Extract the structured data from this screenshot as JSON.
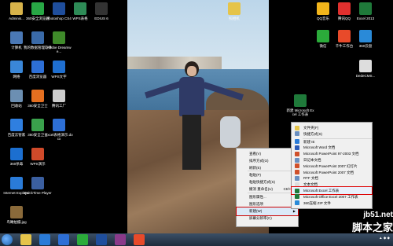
{
  "desktop_icons_left": [
    {
      "label": "Adminis...",
      "color": "#d8b34a"
    },
    {
      "label": "360安全浏览器",
      "color": "#28a745"
    },
    {
      "label": "Photoshop CS4",
      "color": "#1f4e9c"
    },
    {
      "label": "WPS表格",
      "color": "#2e8b57"
    },
    {
      "label": "EDIUS 6",
      "color": "#333333"
    },
    {
      "label": "计算机",
      "color": "#4a78b5"
    },
    {
      "label": "我的数据管理软件",
      "color": "#3a6aa8"
    },
    {
      "label": "Adobe Dreamwe...",
      "color": "#3f8a2a"
    },
    {
      "label": "网络",
      "color": "#3a87d8"
    },
    {
      "label": "百度浏览器",
      "color": "#2d6fd6"
    },
    {
      "label": "WPS文字",
      "color": "#1f6fd0"
    },
    {
      "label": "回收站",
      "color": "#6c8fb2"
    },
    {
      "label": "360安全卫士",
      "color": "#e46f20"
    },
    {
      "label": "腾讯工厂",
      "color": "#cccccc"
    },
    {
      "label": "百度云管家",
      "color": "#2f7fe0"
    },
    {
      "label": "360安全卫士",
      "color": "#3aa14c"
    },
    {
      "label": "Excel表格演示.docx",
      "color": "#2d6fd6"
    },
    {
      "label": "360杀毒",
      "color": "#1c6fd0"
    },
    {
      "label": "WPS演示",
      "color": "#d04a2a"
    },
    {
      "label": "Internet Explorer",
      "color": "#2a7bd8"
    },
    {
      "label": "QuickTime Player",
      "color": "#3b5fa0"
    },
    {
      "label": "鸟瞰拍摄.jpg",
      "color": "#8a6a3a"
    }
  ],
  "desktop_icons_right": [
    {
      "label": "QQ音乐",
      "color": "#f2b51b"
    },
    {
      "label": "腾讯QQ",
      "color": "#e0302e"
    },
    {
      "label": "Excel 2013",
      "color": "#1f7a3a"
    },
    {
      "label": "微信",
      "color": "#2bab3a"
    },
    {
      "label": "千牛工作台",
      "color": "#e84a2a"
    },
    {
      "label": "360云盘",
      "color": "#2a8ad8"
    },
    {
      "label": "DedeCMS...",
      "color": "#dddddd"
    },
    {
      "label": "新建 Microsoft Excel 工作表",
      "color": "#1f7a3a"
    }
  ],
  "wallpaper_folder": {
    "label": "照相机",
    "color": "#e5c44a"
  },
  "context_menu": {
    "items": [
      {
        "label": "查看(V)",
        "arrow": "▶"
      },
      {
        "label": "排序方式(O)",
        "arrow": "▶"
      },
      {
        "label": "刷新(E)",
        "arrow": ""
      },
      {
        "label": "粘贴(P)",
        "arrow": ""
      },
      {
        "label": "粘贴快捷方式(S)",
        "arrow": ""
      },
      {
        "label": "撤消 重命名(U)",
        "shortcut": "Ctrl+Z"
      },
      {
        "label": "图形属性...",
        "arrow": ""
      },
      {
        "label": "图形选项",
        "arrow": "▶"
      },
      {
        "label": "新建(W)",
        "arrow": "▶"
      },
      {
        "label": "屏幕分辨率(C)",
        "arrow": ""
      },
      {
        "label": "小工具(G)",
        "arrow": ""
      },
      {
        "label": "个性化(R)",
        "arrow": ""
      }
    ]
  },
  "new_submenu": {
    "items": [
      {
        "label": "文件夹(F)",
        "color": "#e5c44a"
      },
      {
        "label": "快捷方式(S)",
        "color": "#6a8fc0"
      },
      {
        "label": "新建 IE",
        "color": "#2a7bd8"
      },
      {
        "label": "Microsoft Word 文档",
        "color": "#2a5ab8"
      },
      {
        "label": "Microsoft PowerPoint 97-2003 文档",
        "color": "#d0502a"
      },
      {
        "label": "日记本文档",
        "color": "#6a8fc0"
      },
      {
        "label": "Microsoft PowerPoint 2007 幻灯片",
        "color": "#d0502a"
      },
      {
        "label": "Microsoft PowerPoint 2007 文档",
        "color": "#d0502a"
      },
      {
        "label": "RTF 文档",
        "color": "#6a8fc0"
      },
      {
        "label": "文本文档",
        "color": "#dddddd"
      },
      {
        "label": "Microsoft Excel 工作表",
        "color": "#1f7a3a"
      },
      {
        "label": "Microsoft Office Excel 2007 工作表",
        "color": "#1f7a3a"
      },
      {
        "label": "360压缩 ZIP 文件",
        "color": "#2a8ad8"
      },
      {
        "label": "",
        "color": "#cccccc"
      }
    ]
  },
  "watermark": {
    "url": "jb51.net",
    "cn": "脚本之家"
  }
}
